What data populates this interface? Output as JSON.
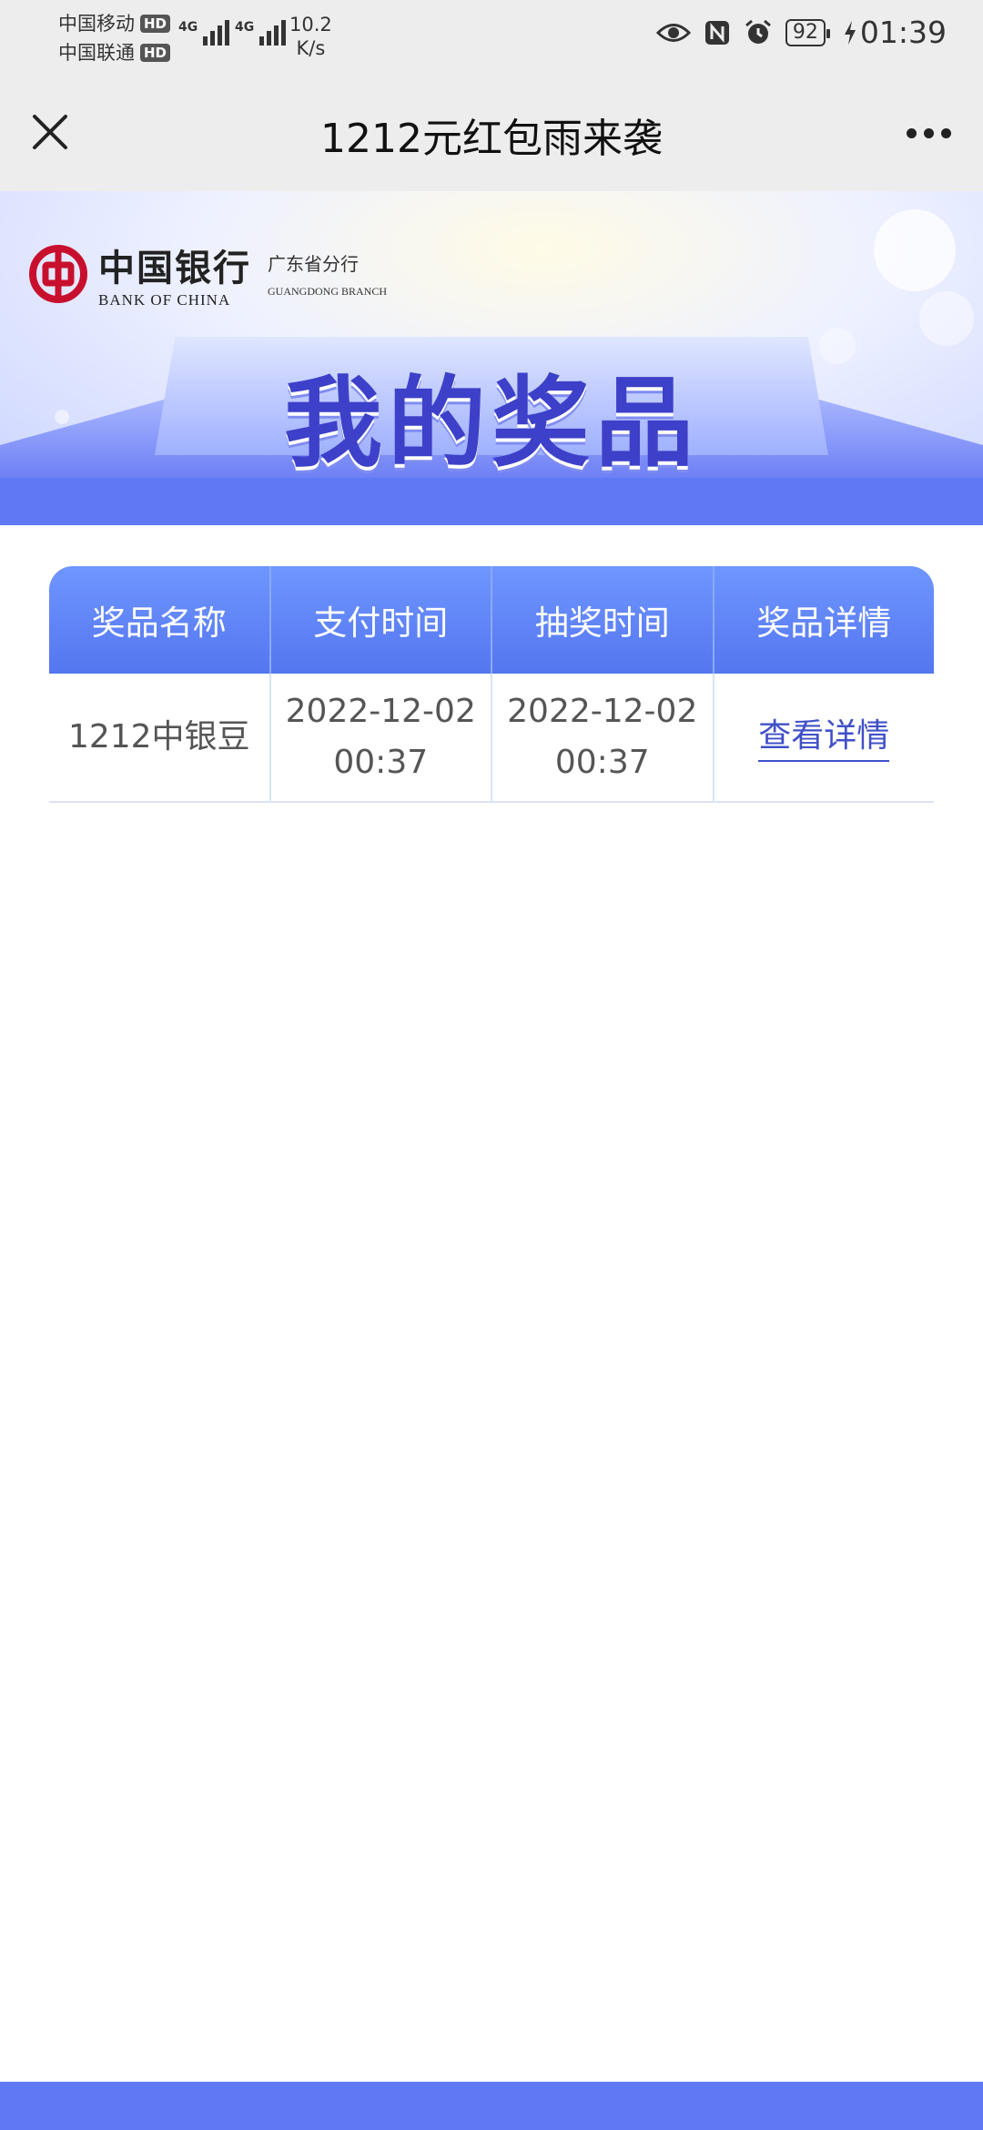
{
  "status_bar": {
    "carrier1": "中国移动",
    "carrier2": "中国联通",
    "hd": "HD",
    "net1": "4G",
    "net2": "4G",
    "speed_value": "10.2",
    "speed_unit": "K/s",
    "battery": "92",
    "time": "01:39"
  },
  "title_bar": {
    "title": "1212元红包雨来袭"
  },
  "banner": {
    "bank_name_cn": "中国银行",
    "bank_name_en": "BANK OF CHINA",
    "branch_cn": "广东省分行",
    "branch_en": "GUANGDONG BRANCH",
    "heading": "我的奖品"
  },
  "table": {
    "headers": [
      "奖品名称",
      "支付时间",
      "抽奖时间",
      "奖品详情"
    ],
    "rows": [
      {
        "name": "1212中银豆",
        "pay_date": "2022-12-02",
        "pay_time": "00:37",
        "draw_date": "2022-12-02",
        "draw_time": "00:37",
        "detail_link": "查看详情"
      }
    ]
  },
  "colors": {
    "accent_blue": "#5f79f4",
    "header_blue": "#5476f0",
    "link_blue": "#4050c8",
    "bank_red": "#c8102e"
  }
}
